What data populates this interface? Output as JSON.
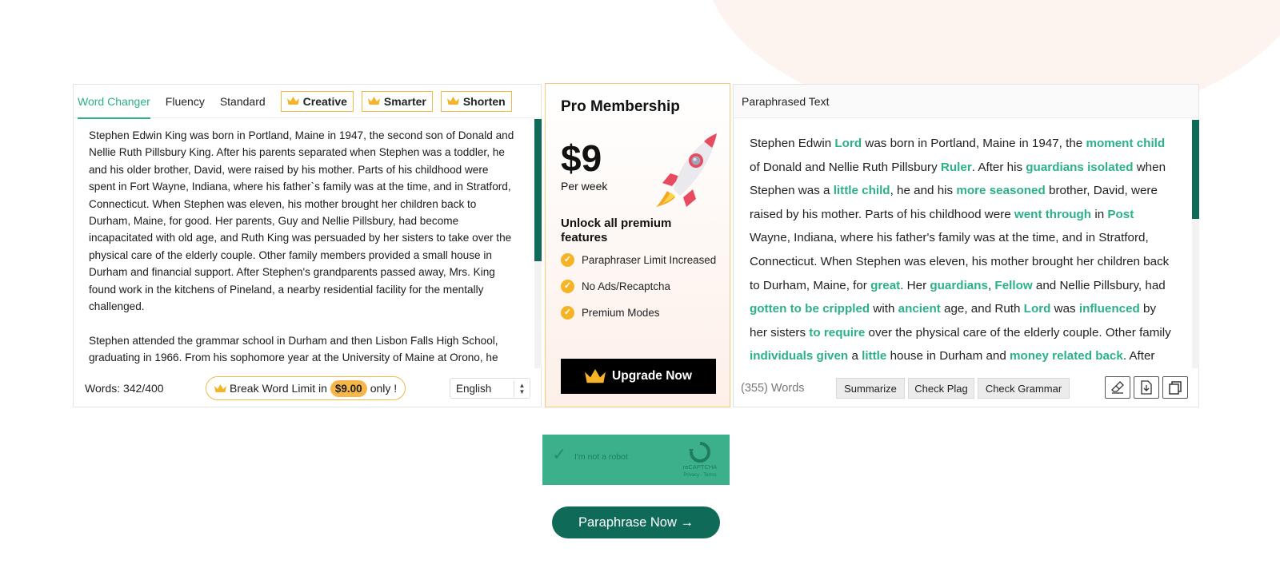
{
  "tabs": [
    {
      "label": "Word Changer",
      "active": true
    },
    {
      "label": "Fluency"
    },
    {
      "label": "Standard"
    }
  ],
  "pro_tabs": [
    {
      "label": "Creative"
    },
    {
      "label": "Smarter"
    },
    {
      "label": "Shorten"
    }
  ],
  "input": {
    "paragraphs": [
      "Stephen Edwin King was born in Portland, Maine in 1947, the second son of Donald and Nellie Ruth Pillsbury King. After his parents separated when Stephen was a toddler, he and his older brother, David, were raised by his mother. Parts of his childhood were spent in Fort Wayne, Indiana, where his father`s family was at the time, and in Stratford, Connecticut. When Stephen was eleven, his mother brought her children back to Durham, Maine, for good. Her parents, Guy and Nellie Pillsbury, had become incapacitated with old age, and Ruth King was persuaded by her sisters to take over the physical care of the elderly couple. Other family members provided a small house in Durham and financial support. After Stephen's grandparents passed away, Mrs. King found work in the kitchens of Pineland, a nearby residential facility for the mentally challenged.",
      "Stephen attended the grammar school in Durham and then Lisbon Falls High School, graduating in 1966. From his sophomore year at the University of Maine at Orono, he wrote a weekly column for the school newspaper, THE MAINE"
    ]
  },
  "left_footer": {
    "word_count": "Words: 342/400",
    "break_prefix": "Break Word Limit in",
    "break_price": "$9.00",
    "break_suffix": "only !",
    "language": "English"
  },
  "pro": {
    "title": "Pro Membership",
    "price": "$9",
    "per": "Per week",
    "unlock": "Unlock all premium features",
    "features": [
      "Paraphraser Limit Increased",
      "No Ads/Recaptcha",
      "Premium Modes"
    ],
    "upgrade_label": "Upgrade Now"
  },
  "output": {
    "header": "Paraphrased Text",
    "word_count": "(355) Words",
    "buttons": [
      "Summarize",
      "Check Plag",
      "Check Grammar"
    ],
    "icons": [
      "eraser-icon",
      "download-icon",
      "copy-icon"
    ]
  },
  "captcha": {
    "label": "I'm not a robot",
    "brand": "reCAPTCHA",
    "links": "Privacy - Terms"
  },
  "cta": {
    "label": "Paraphrase Now →"
  },
  "colors": {
    "accent": "#2bb08a",
    "primary_dark": "#0f6b57",
    "gold": "#f5b74a"
  }
}
